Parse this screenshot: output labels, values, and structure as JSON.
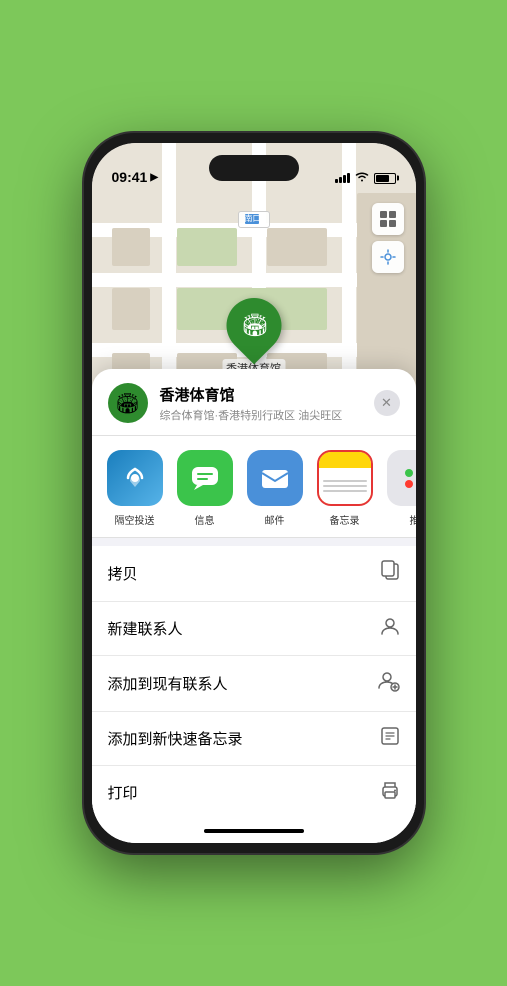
{
  "status_bar": {
    "time": "09:41",
    "location_arrow": "▶"
  },
  "map": {
    "label": "南口",
    "pin_emoji": "🏟",
    "pin_label": "香港体育馆",
    "controls": {
      "map_view": "🗺",
      "location": "➤"
    }
  },
  "place_header": {
    "icon_emoji": "🏟",
    "name": "香港体育馆",
    "subtitle": "综合体育馆·香港特别行政区 油尖旺区",
    "close": "✕"
  },
  "share_items": [
    {
      "id": "airdrop",
      "label": "隔空投送",
      "emoji": "📡"
    },
    {
      "id": "messages",
      "label": "信息",
      "emoji": "💬"
    },
    {
      "id": "mail",
      "label": "邮件",
      "emoji": "✉️"
    },
    {
      "id": "notes",
      "label": "备忘录"
    },
    {
      "id": "more",
      "label": "推",
      "emoji": "···"
    }
  ],
  "action_items": [
    {
      "label": "拷贝",
      "icon": "📋"
    },
    {
      "label": "新建联系人",
      "icon": "👤"
    },
    {
      "label": "添加到现有联系人",
      "icon": "👥"
    },
    {
      "label": "添加到新快速备忘录",
      "icon": "🔲"
    },
    {
      "label": "打印",
      "icon": "🖨"
    }
  ]
}
